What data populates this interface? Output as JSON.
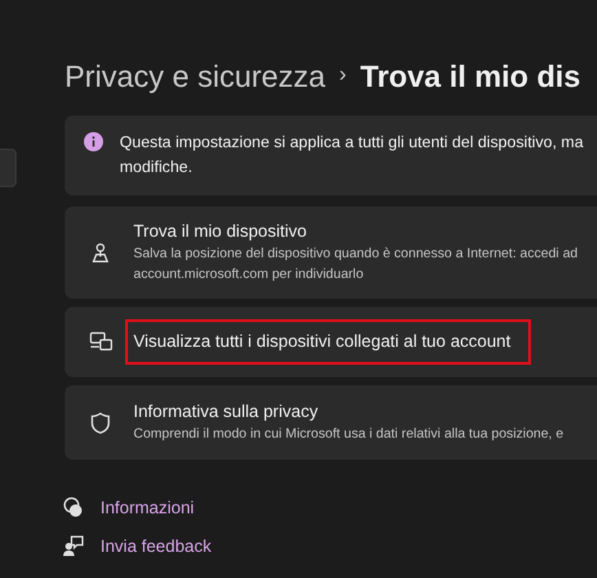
{
  "breadcrumb": {
    "parent": "Privacy e sicurezza",
    "separator": "›",
    "current": "Trova il mio dis"
  },
  "notice": {
    "text": "Questa impostazione si applica a tutti gli utenti del dispositivo, ma",
    "text_line_2": "modifiche."
  },
  "settings": [
    {
      "kind": "location",
      "title": "Trova il mio dispositivo",
      "description": "Salva la posizione del dispositivo quando è connesso a Internet: accedi ad",
      "description_line_2": "account.microsoft.com per individuarlo",
      "highlighted": false
    },
    {
      "kind": "devices",
      "title": "Visualizza tutti i dispositivi collegati al tuo account",
      "highlighted": true
    },
    {
      "kind": "shield",
      "title": "Informativa sulla privacy",
      "description": "Comprendi il modo in cui Microsoft usa i dati relativi alla tua posizione, e",
      "highlighted": false
    }
  ],
  "links": [
    {
      "kind": "help",
      "label": "Informazioni"
    },
    {
      "kind": "feedback",
      "label": "Invia feedback"
    }
  ]
}
